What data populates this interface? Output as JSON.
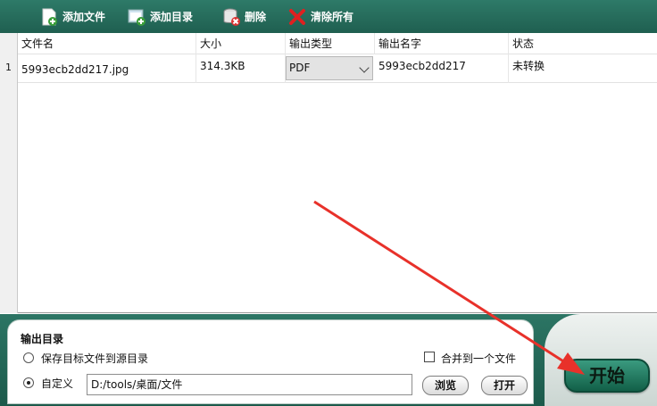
{
  "toolbar": {
    "add_file": "添加文件",
    "add_dir": "添加目录",
    "delete": "删除",
    "clear_all": "清除所有"
  },
  "grid": {
    "headers": [
      "文件名",
      "大小",
      "输出类型",
      "输出名字",
      "状态"
    ],
    "rows": [
      {
        "index": "1",
        "filename": "5993ecb2dd217.jpg",
        "size": "314.3KB",
        "output_type": "PDF",
        "output_name": "5993ecb2dd217",
        "status": "未转换"
      }
    ]
  },
  "output": {
    "title": "输出目录",
    "option_source": "保存目标文件到源目录",
    "option_custom": "自定义",
    "path": "D:/tools/桌面/文件",
    "merge_label": "合并到一个文件",
    "browse": "浏览",
    "open": "打开",
    "selected_option": "custom",
    "merge_checked": false
  },
  "start_button": "开始",
  "colors": {
    "toolbar_bg": "#246b5b",
    "annotation_arrow": "#e8312a"
  }
}
